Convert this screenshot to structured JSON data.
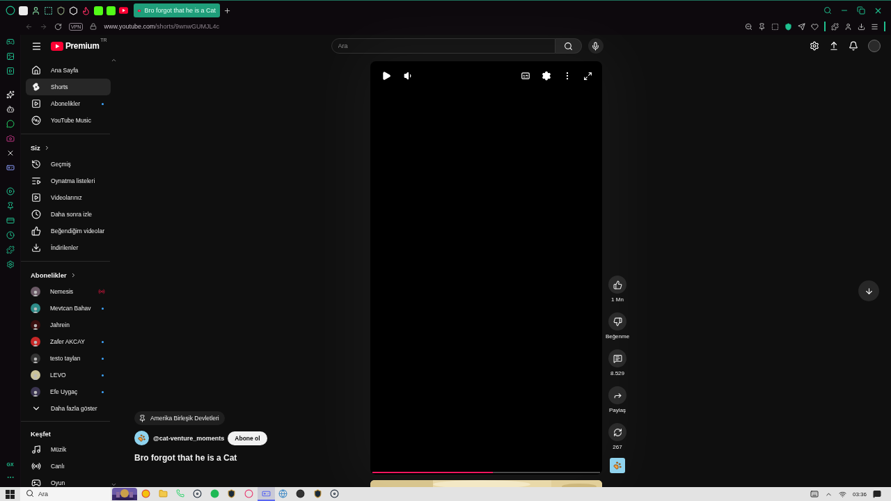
{
  "browser": {
    "active_tab": {
      "title": "Bro forgot that he is a Cat"
    },
    "address_bar": {
      "vpn_label": "VPN",
      "domain": "www.youtube.com",
      "path": "/shorts/9wnwGUMJL4c"
    },
    "sidebar_label": "GX"
  },
  "youtube": {
    "logo_text": "Premium",
    "region": "TR",
    "search": {
      "placeholder": "Ara"
    },
    "guide": {
      "main": [
        {
          "kind": "home",
          "label": "Ana Sayfa",
          "selected": false,
          "new_content": false
        },
        {
          "kind": "shorts",
          "label": "Shorts",
          "selected": true,
          "new_content": false
        },
        {
          "kind": "subscriptions",
          "label": "Abonelikler",
          "selected": false,
          "new_content": true
        },
        {
          "kind": "music",
          "label": "YouTube Music",
          "selected": false,
          "new_content": false
        }
      ],
      "you_heading": "Siz",
      "you_items": [
        {
          "kind": "history",
          "label": "Geçmiş"
        },
        {
          "kind": "playlists",
          "label": "Oynatma listeleri"
        },
        {
          "kind": "videos",
          "label": "Videolarınız"
        },
        {
          "kind": "watch_later",
          "label": "Daha sonra izle"
        },
        {
          "kind": "liked",
          "label": "Beğendiğim videolar"
        },
        {
          "kind": "downloads",
          "label": "İndirilenler"
        }
      ],
      "subs_heading": "Abonelikler",
      "channels": [
        {
          "name": "Nemesis",
          "live": true,
          "new_content": false
        },
        {
          "name": "Mevtcan Bahav",
          "live": false,
          "new_content": true
        },
        {
          "name": "Jahrein",
          "live": false,
          "new_content": false
        },
        {
          "name": "Zafer AKCAY",
          "live": false,
          "new_content": true
        },
        {
          "name": "testo taylan",
          "live": false,
          "new_content": true
        },
        {
          "name": "LEVO",
          "live": false,
          "new_content": true
        },
        {
          "name": "Efe Uygaç",
          "live": false,
          "new_content": true
        }
      ],
      "show_more": "Daha fazla göster",
      "explore_heading": "Keşfet",
      "explore_items": [
        {
          "kind": "music_note",
          "label": "Müzik"
        },
        {
          "kind": "live",
          "label": "Canlı"
        },
        {
          "kind": "gaming",
          "label": "Oyun"
        }
      ]
    },
    "short": {
      "location": "Amerika Birleşik Devletleri",
      "channel": "@cat-venture_moments",
      "subscribe": "Abone ol",
      "title": "Bro forgot that he is a Cat",
      "progress": {
        "level": 0.53
      },
      "actions": [
        {
          "kind": "like",
          "label": "1 Mn"
        },
        {
          "kind": "dislike",
          "label": "Beğenme"
        },
        {
          "kind": "comment",
          "label": "8.529"
        },
        {
          "kind": "share",
          "label": "Paylaş"
        },
        {
          "kind": "remix",
          "label": "267"
        }
      ]
    }
  },
  "taskbar": {
    "search": {
      "placeholder": "Ara"
    },
    "apps": [
      {
        "kind": "chrome",
        "selected": false
      },
      {
        "kind": "folder",
        "selected": false
      },
      {
        "kind": "chat",
        "selected": false
      },
      {
        "kind": "steam",
        "selected": false
      },
      {
        "kind": "spotify",
        "selected": false
      },
      {
        "kind": "league",
        "selected": false
      },
      {
        "kind": "opera",
        "selected": false
      },
      {
        "kind": "discord",
        "selected": true
      },
      {
        "kind": "network",
        "selected": false
      },
      {
        "kind": "media",
        "selected": false
      },
      {
        "kind": "league",
        "selected": false
      },
      {
        "kind": "steam",
        "selected": false
      }
    ],
    "clock": "03:36"
  }
}
